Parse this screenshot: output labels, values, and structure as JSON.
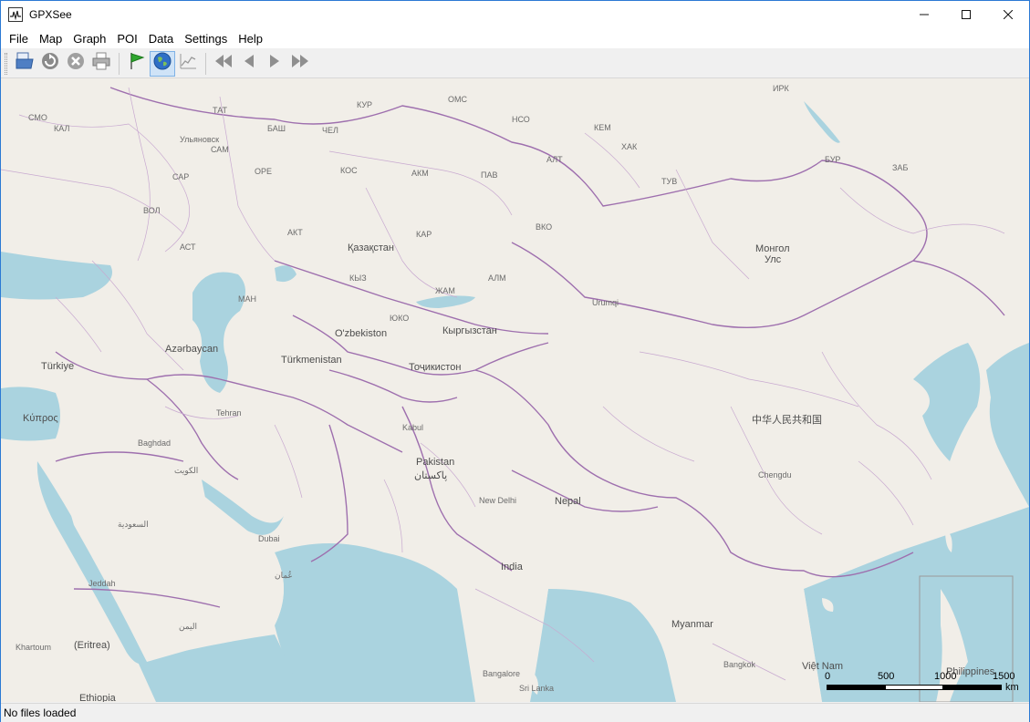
{
  "window": {
    "title": "GPXSee"
  },
  "menu": [
    {
      "label": "File"
    },
    {
      "label": "Map"
    },
    {
      "label": "Graph"
    },
    {
      "label": "POI"
    },
    {
      "label": "Data"
    },
    {
      "label": "Settings"
    },
    {
      "label": "Help"
    }
  ],
  "toolbar": {
    "buttons": [
      "open-icon",
      "reload-icon",
      "close-icon",
      "print-icon",
      "poi-flag-icon",
      "map-globe-icon",
      "graph-icon",
      "first-icon",
      "previous-icon",
      "next-icon",
      "last-icon"
    ]
  },
  "map": {
    "labels": [
      {
        "text": "Қазақстан",
        "big": true
      },
      {
        "text": "Монгол",
        "big": true
      },
      {
        "text": "Улс",
        "big": true
      },
      {
        "text": "O'zbekiston",
        "big": true
      },
      {
        "text": "Кыргызстан",
        "big": true
      },
      {
        "text": "Тоҷикистон",
        "big": true
      },
      {
        "text": "Türkmenistan",
        "big": true
      },
      {
        "text": "Azərbaycan",
        "big": true
      },
      {
        "text": "Türkiye",
        "big": true
      },
      {
        "text": "Κύπρος",
        "big": true
      },
      {
        "text": "中华人民共和国",
        "big": true
      },
      {
        "text": "Pakistan",
        "big": true
      },
      {
        "text": "پاکستان",
        "big": true
      },
      {
        "text": "Nepal",
        "big": true
      },
      {
        "text": "India",
        "big": true
      },
      {
        "text": "Myanmar",
        "big": true
      },
      {
        "text": "Việt Nam",
        "big": true
      },
      {
        "text": "Philippines",
        "big": true
      },
      {
        "text": "Ethiopia",
        "big": true
      },
      {
        "text": "(Eritrea)",
        "big": true
      },
      {
        "text": "Urumqi",
        "big": false
      },
      {
        "text": "Chengdu",
        "big": false
      },
      {
        "text": "New Delhi",
        "big": false
      },
      {
        "text": "Kabul",
        "big": false
      },
      {
        "text": "Tehran",
        "big": false
      },
      {
        "text": "Baghdad",
        "big": false
      },
      {
        "text": "Dubai",
        "big": false
      },
      {
        "text": "Jeddah",
        "big": false
      },
      {
        "text": "Khartoum",
        "big": false
      },
      {
        "text": "Bangalore",
        "big": false
      },
      {
        "text": "Bangkok",
        "big": false
      },
      {
        "text": "ОМС",
        "big": false
      },
      {
        "text": "НСО",
        "big": false
      },
      {
        "text": "АЛТ",
        "big": false
      },
      {
        "text": "ИРК",
        "big": false
      },
      {
        "text": "БУР",
        "big": false
      },
      {
        "text": "ЗАБ",
        "big": false
      },
      {
        "text": "КЕМ",
        "big": false
      },
      {
        "text": "ХАК",
        "big": false
      },
      {
        "text": "ТУВ",
        "big": false
      },
      {
        "text": "ПАВ",
        "big": false
      },
      {
        "text": "АКМ",
        "big": false
      },
      {
        "text": "КОС",
        "big": false
      },
      {
        "text": "КАР",
        "big": false
      },
      {
        "text": "ВКО",
        "big": false
      },
      {
        "text": "АЛМ",
        "big": false
      },
      {
        "text": "ЖАМ",
        "big": false
      },
      {
        "text": "КЫЗ",
        "big": false
      },
      {
        "text": "АКТ",
        "big": false
      },
      {
        "text": "МАН",
        "big": false
      },
      {
        "text": "ЮКО",
        "big": false
      },
      {
        "text": "ЧЕЛ",
        "big": false
      },
      {
        "text": "КУР",
        "big": false
      },
      {
        "text": "БАШ",
        "big": false
      },
      {
        "text": "ОРЕ",
        "big": false
      },
      {
        "text": "САМ",
        "big": false
      },
      {
        "text": "САР",
        "big": false
      },
      {
        "text": "ВОЛ",
        "big": false
      },
      {
        "text": "АСТ",
        "big": false
      },
      {
        "text": "КАЛ",
        "big": false
      },
      {
        "text": "СМО",
        "big": false
      },
      {
        "text": "ТАТ",
        "big": false
      },
      {
        "text": "Ульяновск",
        "big": false
      },
      {
        "text": "الكويت",
        "big": false
      },
      {
        "text": "عُمان",
        "big": false
      },
      {
        "text": "السعودية",
        "big": false
      },
      {
        "text": "اليمن",
        "big": false
      },
      {
        "text": "Sri Lanka",
        "big": false
      }
    ]
  },
  "scale": {
    "ticks": [
      "0",
      "500",
      "1000",
      "1500"
    ],
    "unit": "km"
  },
  "status": {
    "text": "No files loaded"
  },
  "colors": {
    "land": "#f1eee8",
    "water": "#aad3df",
    "border": "#9e6fae",
    "accent": "#2b79d4"
  }
}
